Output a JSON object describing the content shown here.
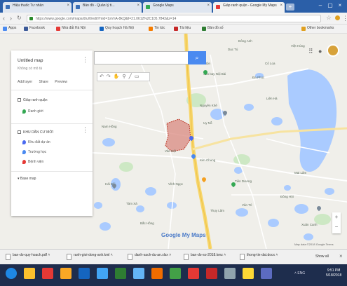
{
  "browser": {
    "tabs": [
      {
        "label": "Hiệu thuốc Tư nhân",
        "color": "#3b6fb6"
      },
      {
        "label": "Bản đồ - Quản lý ti...",
        "color": "#3b6fb6"
      },
      {
        "label": "Google Maps",
        "color": "#34a853"
      },
      {
        "label": "Giáp ranh quận - Google My Maps",
        "color": "#e53935"
      }
    ],
    "new_tab": "+",
    "address": "https://www.google.com/maps/d/u/0/edit?mid=1xVnA-8kQ&ll=21.0612%2C105.7843&z=14",
    "bookmarks": [
      {
        "label": "Apps",
        "color": "#4a8af0"
      },
      {
        "label": "Facebook",
        "color": "#3b5998"
      },
      {
        "label": "Nhà đất Hà Nội",
        "color": "#e53935"
      },
      {
        "label": "Quy hoạch Hà Nội",
        "color": "#1565c0"
      },
      {
        "label": "Tin tức",
        "color": "#f57c00"
      },
      {
        "label": "Tài liệu",
        "color": "#c62828"
      },
      {
        "label": "Bản đồ số",
        "color": "#2e7d32"
      },
      {
        "label": "Other bookmarks",
        "color": "#e0a020"
      }
    ]
  },
  "panel": {
    "title": "Untitled map",
    "subtitle": "Không có mô tả",
    "actions": [
      "Add layer",
      "Share",
      "Preview"
    ],
    "layers": [
      {
        "label": "Giáp ranh quận",
        "items": [
          {
            "label": "Ranh giới",
            "color": "#4a8af0"
          }
        ]
      },
      {
        "label": "KHU DÂN CƯ MỚI",
        "items": [
          {
            "label": "Khu đất dự án",
            "color": "#4a6af0"
          },
          {
            "label": "Trường học",
            "color": "#4a8af0"
          },
          {
            "label": "Bệnh viện",
            "color": "#e53935"
          }
        ]
      }
    ],
    "basemap": "Base map"
  },
  "map": {
    "search_icon": "search-icon",
    "labels": [
      "Đông Anh",
      "Cổ Loa",
      "Xuân Nộn",
      "Nguyên Khê",
      "Uy Nỗ",
      "Vân Nội",
      "Kim Chung",
      "Hải Bối",
      "Vĩnh Ngọc",
      "Tiên Dương",
      "Tàm Xá",
      "Đông Hội",
      "Mai Lâm",
      "Vân Trì",
      "Thụy Lâm",
      "Liên Hà",
      "Việt Hùng",
      "Dục Tú",
      "Nam Hồng",
      "Bắc Hồng",
      "Xuân Canh",
      "Đa Phúc",
      "Sân bay Nội Bài"
    ],
    "logo": "Google My Maps",
    "attribution": "Map data ©2018 Google  Terms",
    "zoom_in": "+",
    "zoom_out": "−"
  },
  "downloads": {
    "items": [
      "ban-do-quy-hoach.pdf",
      "ranh-gioi-dong-anh.kml",
      "danh-sach-du-an.xlsx",
      "ban-do-so-2018.kmz",
      "thong-tin-dat.docx"
    ],
    "show_all": "Show all"
  },
  "taskbar": {
    "icons": [
      "#1e88e5",
      "#fbc02d",
      "#e53935",
      "#f9a825",
      "#1565c0",
      "#42a5f5",
      "#2e7d32",
      "#64b5f6",
      "#ef6c00",
      "#43a047",
      "#e53935",
      "#c62828",
      "#90a4ae",
      "#fdd835",
      "#5c6bc0"
    ],
    "tray": "ENG",
    "time": "9:51 PM",
    "date": "5/18/2018"
  }
}
